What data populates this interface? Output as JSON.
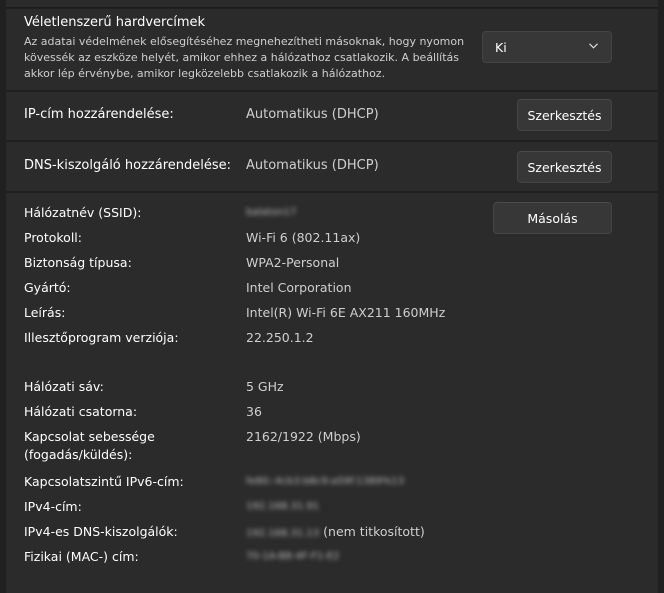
{
  "random_mac": {
    "title": "Véletlenszerű hardvercímek",
    "description": "Az adatai védelmének elősegítéséhez megnehezítheti másoknak, hogy nyomon kövessék az eszköze helyét, amikor ehhez a hálózathoz csatlakozik. A beállítás akkor lép érvénybe, amikor legközelebb csatlakozik a hálózathoz.",
    "selected": "Ki",
    "chevron_icon": "chevron-down-icon"
  },
  "ip_assignment": {
    "label": "IP-cím hozzárendelése:",
    "value": "Automatikus (DHCP)",
    "button": "Szerkesztés"
  },
  "dns_assignment": {
    "label": "DNS-kiszolgáló hozzárendelése:",
    "value": "Automatikus (DHCP)",
    "button": "Szerkesztés"
  },
  "properties": {
    "copy_button": "Másolás",
    "ssid": {
      "label": "Hálózatnév (SSID):",
      "value": "balaton17"
    },
    "protocol": {
      "label": "Protokoll:",
      "value": "Wi-Fi 6 (802.11ax)"
    },
    "security": {
      "label": "Biztonság típusa:",
      "value": "WPA2-Personal"
    },
    "manufacturer": {
      "label": "Gyártó:",
      "value": "Intel Corporation"
    },
    "description": {
      "label": "Leírás:",
      "value": "Intel(R) Wi-Fi 6E AX211 160MHz"
    },
    "driver": {
      "label": "Illesztőprogram verziója:",
      "value": "22.250.1.2"
    },
    "band": {
      "label": "Hálózati sáv:",
      "value": "5 GHz"
    },
    "channel": {
      "label": "Hálózati csatorna:",
      "value": "36"
    },
    "speed": {
      "label": "Kapcsolat sebessége (fogadás/küldés):",
      "value": "2162/1922 (Mbps)"
    },
    "ipv6": {
      "label": "Kapcsolatszintű IPv6-cím:",
      "value": "fe80::4cb3:b8c9:a59f:1389%13"
    },
    "ipv4": {
      "label": "IPv4-cím:",
      "value": "192.168.31.91"
    },
    "ipv4_dns_value": "192.168.31.13",
    "ipv4_dns": {
      "label": "IPv4-es DNS-kiszolgálók:",
      "suffix": "(nem titkosított)"
    },
    "mac": {
      "label": "Fizikai (MAC-) cím:",
      "value": "70-1A-B8-4F-F1-E2"
    }
  }
}
